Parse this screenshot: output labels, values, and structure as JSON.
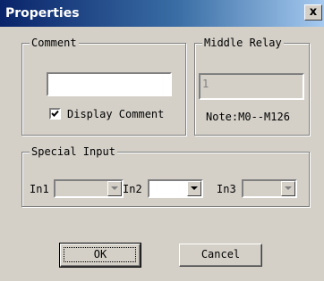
{
  "window": {
    "title": "Properties",
    "close_glyph": "x"
  },
  "comment_group": {
    "legend": "Comment",
    "comment_value": "",
    "display_comment_label": "Display Comment",
    "display_comment_checked": true
  },
  "relay_group": {
    "legend": "Middle Relay",
    "relay_value": "1",
    "note": "Note:M0--M126"
  },
  "special_input_group": {
    "legend": "Special Input",
    "inputs": [
      {
        "label": "In1",
        "value": "",
        "enabled": false
      },
      {
        "label": "In2",
        "value": "",
        "enabled": true
      },
      {
        "label": "In3",
        "value": "",
        "enabled": false
      }
    ]
  },
  "buttons": {
    "ok_label": "OK",
    "cancel_label": "Cancel"
  },
  "icons": {
    "close": "close-icon",
    "check": "check-icon",
    "dropdown": "chevron-down-icon"
  }
}
